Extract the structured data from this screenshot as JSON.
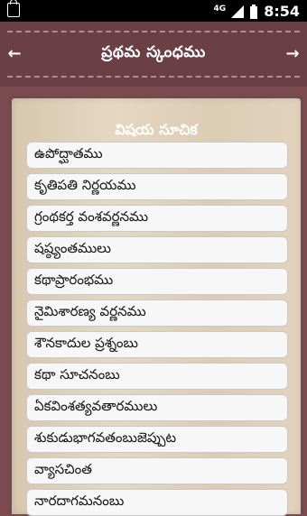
{
  "status_bar": {
    "network": "4G",
    "time": "8:54"
  },
  "header": {
    "title": "ప్రథమ స్కంధము",
    "back_icon": "arrow-left",
    "forward_icon": "arrow-right"
  },
  "panel": {
    "title": "విషయ సూచిక"
  },
  "items": [
    {
      "label": "ఉపోద్ఘాతము"
    },
    {
      "label": "కృతిపతి నిర్ణయము"
    },
    {
      "label": "గ్రంథకర్త వంశవర్ణనము"
    },
    {
      "label": "షష్ఠ్యంతములు"
    },
    {
      "label": "కథాప్రారంభము"
    },
    {
      "label": "నైమిశారణ్య వర్ణనము"
    },
    {
      "label": "శౌనకాదుల ప్రశ్నంబు"
    },
    {
      "label": "కథా సూచనంబు"
    },
    {
      "label": "ఏకవింశత్యవతారములు"
    },
    {
      "label": "శుకుడుభాగవతంబుజెప్పుట"
    },
    {
      "label": "వ్యాసచింత"
    },
    {
      "label": "నారదాగమనంబు"
    }
  ]
}
